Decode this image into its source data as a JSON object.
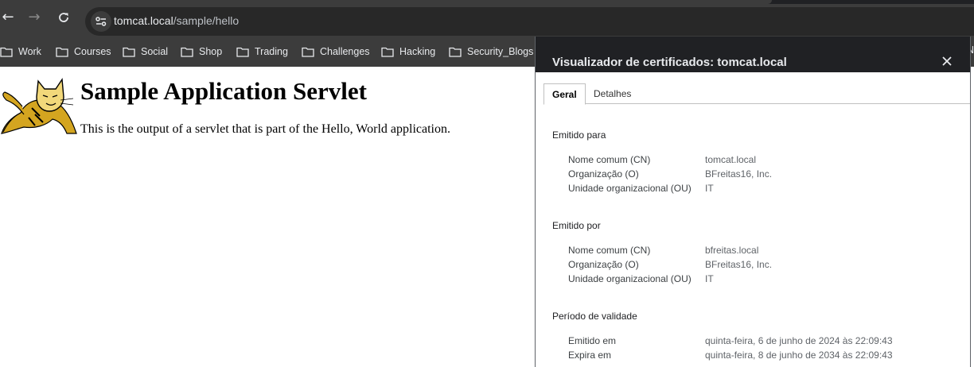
{
  "browser": {
    "url_host": "tomcat.local",
    "url_path": "/sample/hello",
    "bookmarks": [
      "Work",
      "Courses",
      "Social",
      "Shop",
      "Trading",
      "Challenges",
      "Hacking",
      "Security_Blogs"
    ],
    "bookmark_overflow": "N"
  },
  "page": {
    "title": "Sample Application Servlet",
    "text": "This is the output of a servlet that is part of the Hello, World application."
  },
  "dialog": {
    "title": "Visualizador de certificados: tomcat.local",
    "tabs": [
      "Geral",
      "Detalhes"
    ],
    "issued_to": {
      "heading": "Emitido para",
      "rows": [
        {
          "label": "Nome comum (CN)",
          "value": "tomcat.local"
        },
        {
          "label": "Organização (O)",
          "value": "BFreitas16, Inc."
        },
        {
          "label": "Unidade organizacional (OU)",
          "value": "IT"
        }
      ]
    },
    "issued_by": {
      "heading": "Emitido por",
      "rows": [
        {
          "label": "Nome comum (CN)",
          "value": "bfreitas.local"
        },
        {
          "label": "Organização (O)",
          "value": "BFreitas16, Inc."
        },
        {
          "label": "Unidade organizacional (OU)",
          "value": "IT"
        }
      ]
    },
    "validity": {
      "heading": "Período de validade",
      "rows": [
        {
          "label": "Emitido em",
          "value": "quinta-feira, 6 de junho de 2024 às 22:09:43"
        },
        {
          "label": "Expira em",
          "value": "quinta-feira, 8 de junho de 2034 às 22:09:43"
        }
      ]
    }
  }
}
